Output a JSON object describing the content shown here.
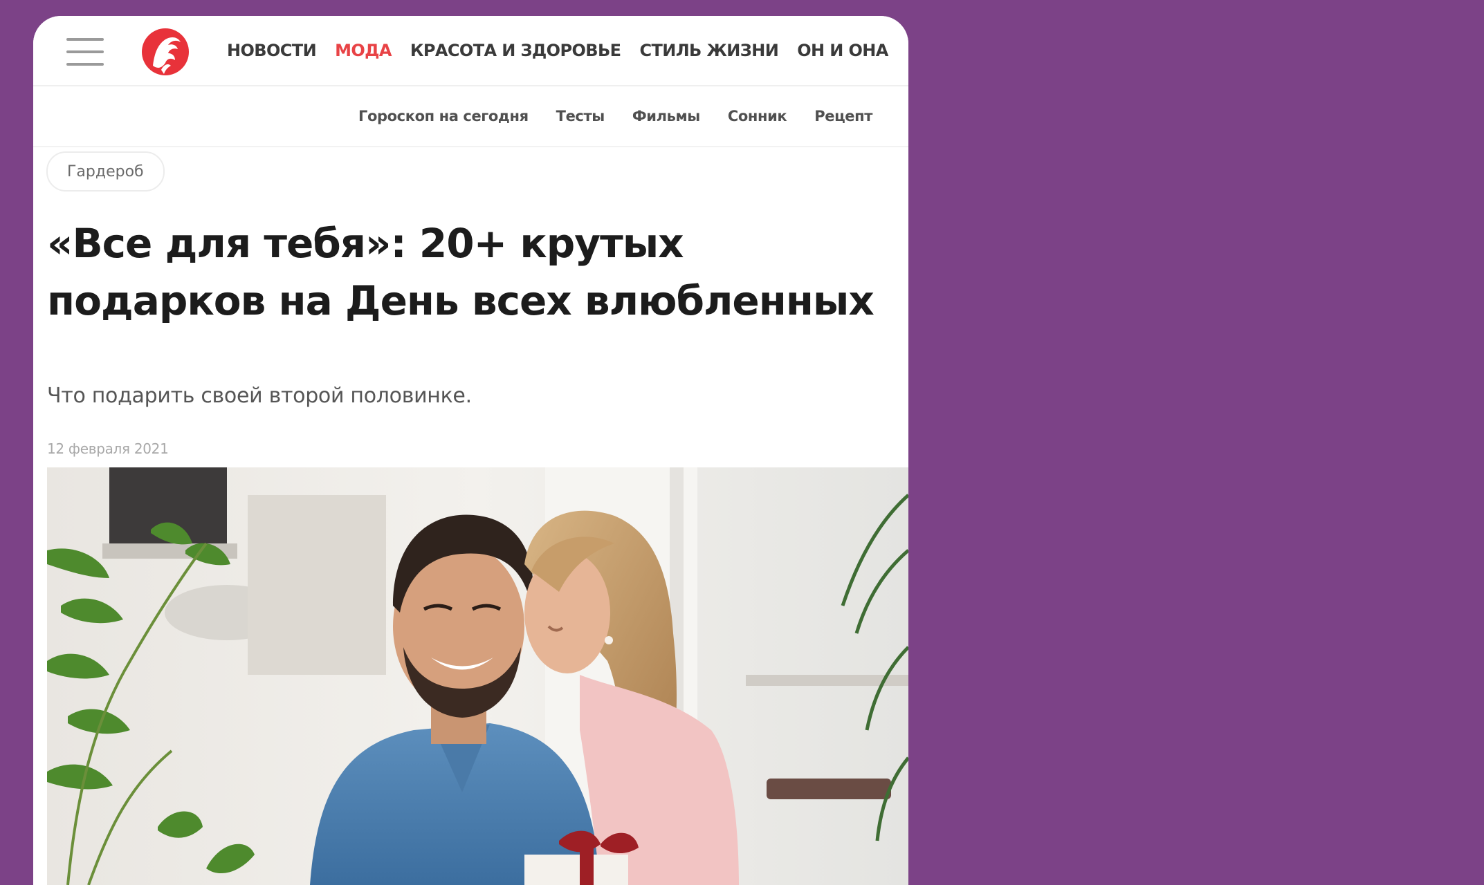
{
  "header": {
    "menu_icon": "hamburger-menu-icon",
    "logo_icon": "woman-profile-logo-icon",
    "nav": [
      {
        "label": "НОВОСТИ",
        "active": false
      },
      {
        "label": "МОДА",
        "active": true
      },
      {
        "label": "КРАСОТА И ЗДОРОВЬЕ",
        "active": false
      },
      {
        "label": "СТИЛЬ ЖИЗНИ",
        "active": false
      },
      {
        "label": "ОН И ОНА",
        "active": false
      }
    ],
    "subnav": [
      "Гороскоп на сегодня",
      "Тесты",
      "Фильмы",
      "Сонник",
      "Рецепт"
    ]
  },
  "article": {
    "tag": "Гардероб",
    "title": "«Все для тебя»: 20+ крутых подарков на День всех влюбленных",
    "lead": "Что подарить своей второй половинке.",
    "date": "12 февраля 2021"
  },
  "colors": {
    "background": "#7c4287",
    "accent": "#e84346",
    "card": "#ffffff",
    "nav_text": "#3a3a3a"
  }
}
